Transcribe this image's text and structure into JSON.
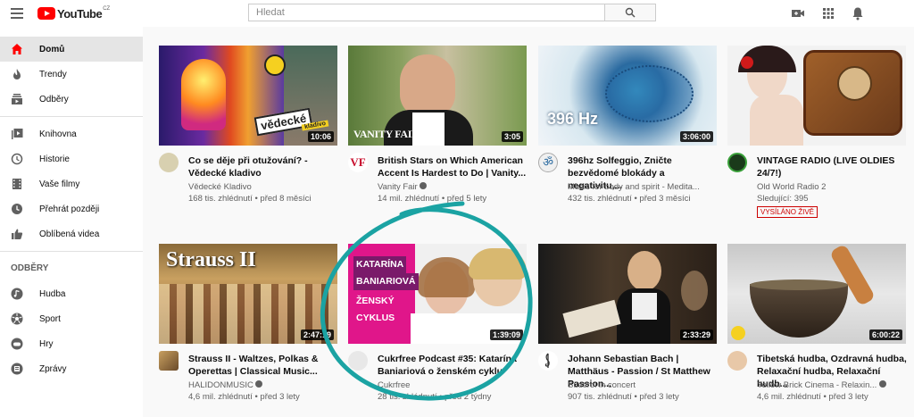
{
  "header": {
    "logo_text": "YouTube",
    "logo_country": "CZ",
    "search_placeholder": "Hledat"
  },
  "sidebar": {
    "main_items": [
      {
        "label": "Domů",
        "icon": "home-icon"
      },
      {
        "label": "Trendy",
        "icon": "flame-icon"
      },
      {
        "label": "Odběry",
        "icon": "subscriptions-icon"
      }
    ],
    "library_items": [
      {
        "label": "Knihovna",
        "icon": "library-icon"
      },
      {
        "label": "Historie",
        "icon": "history-icon"
      },
      {
        "label": "Vaše filmy",
        "icon": "film-icon"
      },
      {
        "label": "Přehrát později",
        "icon": "clock-icon"
      },
      {
        "label": "Oblíbená videa",
        "icon": "thumbs-up-icon"
      }
    ],
    "subscriptions_heading": "ODBĚRY",
    "subscription_items": [
      {
        "label": "Hudba",
        "icon": "music-icon"
      },
      {
        "label": "Sport",
        "icon": "sport-icon"
      },
      {
        "label": "Hry",
        "icon": "games-icon"
      },
      {
        "label": "Zprávy",
        "icon": "news-icon"
      }
    ]
  },
  "videos": [
    {
      "title": "Co se děje při otužování? - Vědecké kladivo",
      "channel": "Vědecké Kladivo",
      "stats": "168 tis. zhlédnutí • před 8 měsíci",
      "duration": "10:06",
      "thumb_text": "vědecké",
      "thumb_text2": "kladivo"
    },
    {
      "title": "British Stars on Which American Accent Is Hardest to Do | Vanity...",
      "channel": "Vanity Fair",
      "stats": "14 mil. zhlédnutí • před 5 lety",
      "duration": "3:05",
      "thumb_text": "VANITY FAIR",
      "avatar_text": "VF"
    },
    {
      "title": "396hz Solfeggio, Zničte bezvědomé blokády a negativitu,...",
      "channel": "Music for body and spirit - Medita...",
      "stats": "432 tis. zhlédnutí • před 3 měsíci",
      "duration": "3:06:00",
      "thumb_text": "396 Hz",
      "avatar_text": "ॐ"
    },
    {
      "title": "VINTAGE RADIO (LIVE OLDIES 24/7!)",
      "channel": "Old World Radio 2",
      "stats": "Sledující: 395",
      "live": "VYSÍLÁNO ŽIVĚ"
    },
    {
      "title": "Strauss II - Waltzes, Polkas & Operettas | Classical Music...",
      "channel": "HALIDONMUSIC",
      "stats": "4,6 mil. zhlédnutí • před 3 lety",
      "duration": "2:47:19",
      "thumb_text": "Strauss II"
    },
    {
      "title": "Cukrfree Podcast #35: Katarína Baniariová o ženském cyklu",
      "channel": "Cukrfree",
      "stats": "28 tis. zhlédnutí • před 2 týdny",
      "duration": "1:39:09",
      "thumb_lines": [
        "KATARÍNA",
        "BANIARIOVÁ",
        "ŽENSKÝ",
        "CYKLUS"
      ]
    },
    {
      "title": "Johann Sebastian Bach | Matthäus - Passion / St Matthew Passion...",
      "channel": "Südtirol in concert",
      "stats": "907 tis. zhlédnutí • před 3 lety",
      "duration": "2:33:29"
    },
    {
      "title": "Tibetská hudba, Ozdravná hudba, Relaxační hudba, Relaxační hudb...",
      "channel": "Yellow Brick Cinema - Relaxin...",
      "stats": "4,6 mil. zhlédnutí • před 3 lety",
      "duration": "6:00:22"
    }
  ]
}
